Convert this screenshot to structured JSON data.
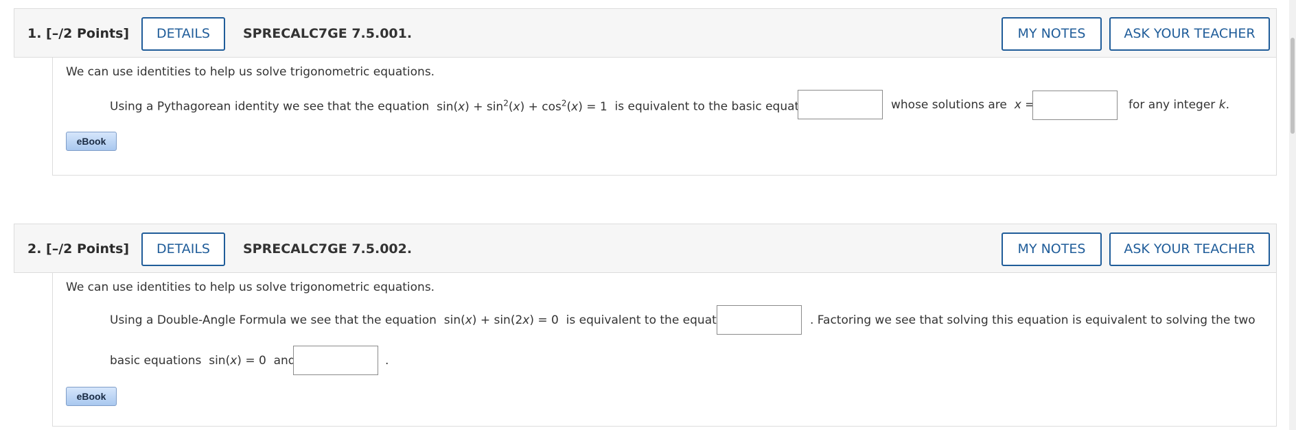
{
  "questions": [
    {
      "title": "1.  [–/2 Points]",
      "details_label": "DETAILS",
      "code": "SPRECALC7GE 7.5.001.",
      "my_notes_label": "MY NOTES",
      "ask_teacher_label": "ASK YOUR TEACHER",
      "intro": "We can use identities to help us solve trigonometric equations.",
      "line1": {
        "t1": "Using a Pythagorean identity we see that the equation",
        "eq_a": "sin(",
        "eq_x1": "x",
        "eq_b": ") + sin",
        "eq_sup1": "2",
        "eq_c": "(",
        "eq_x2": "x",
        "eq_d": ") + cos",
        "eq_sup2": "2",
        "eq_e": "(",
        "eq_x3": "x",
        "eq_f": ") = 1",
        "t2": "is equivalent to the basic equation",
        "t3": "whose solutions are",
        "x_var": "x",
        "eq_sign": " =",
        "t4": "for any integer",
        "k_var": "k",
        "period": "."
      },
      "ebook_label": "eBook"
    },
    {
      "title": "2.  [–/2 Points]",
      "details_label": "DETAILS",
      "code": "SPRECALC7GE 7.5.002.",
      "my_notes_label": "MY NOTES",
      "ask_teacher_label": "ASK YOUR TEACHER",
      "intro": "We can use identities to help us solve trigonometric equations.",
      "line1": {
        "t1": "Using a Double-Angle Formula we see that the equation",
        "eq_a": "sin(",
        "eq_x1": "x",
        "eq_b": ") + sin(2",
        "eq_x2": "x",
        "eq_c": ") = 0",
        "t2": "is equivalent to the equation",
        "t3": ". Factoring we see that solving this equation is equivalent to solving the two"
      },
      "line2": {
        "t1": "basic equations",
        "eq_a": "sin(",
        "eq_x": "x",
        "eq_b": ") = 0",
        "t2": "and",
        "period": "."
      },
      "ebook_label": "eBook"
    }
  ]
}
